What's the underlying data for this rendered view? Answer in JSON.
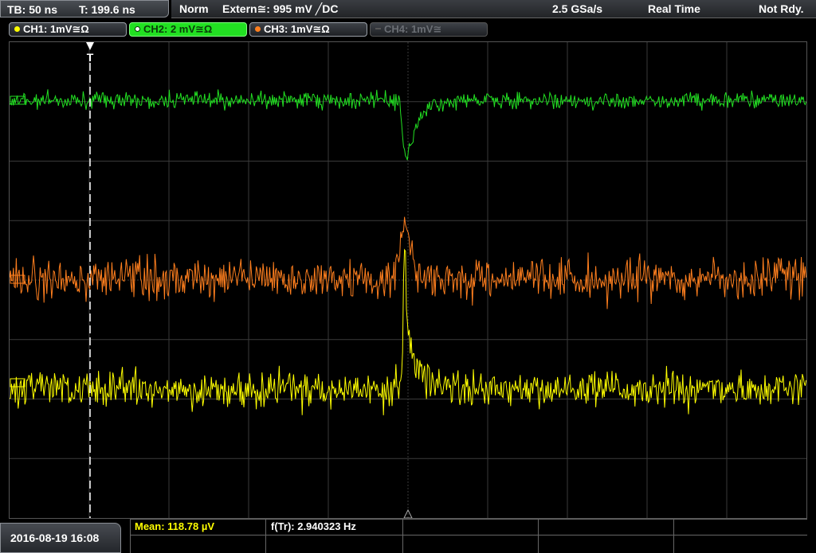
{
  "topbar": {
    "tb": "TB: 50 ns",
    "t": "T: 199.6 ns",
    "mode": "Norm",
    "trigger": "Extern≅: 995 mV ╱DC",
    "rate": "2.5 GSa/s",
    "realtime": "Real Time",
    "status": "Not Rdy."
  },
  "channels": [
    {
      "label": "CH1: 1mV≅Ω",
      "color": "#ffff00"
    },
    {
      "label": "CH2: 2 mV≅Ω",
      "color": "#22e022"
    },
    {
      "label": "CH3: 1mV≅Ω",
      "color": "#ff7f1e"
    },
    {
      "label": "CH4: 1mV≅",
      "color": "#666666"
    }
  ],
  "trigger_marker": "T",
  "bottom": {
    "datetime": "2016-08-19 16:08",
    "mean_label": "Mean: 118.78 µV",
    "freq_label": "f(Tr): 2.940323 Hz"
  },
  "colors": {
    "ch1": "#ffff00",
    "ch2": "#22e022",
    "ch3": "#ff7f1e",
    "grid": "#3a3a3a"
  }
}
